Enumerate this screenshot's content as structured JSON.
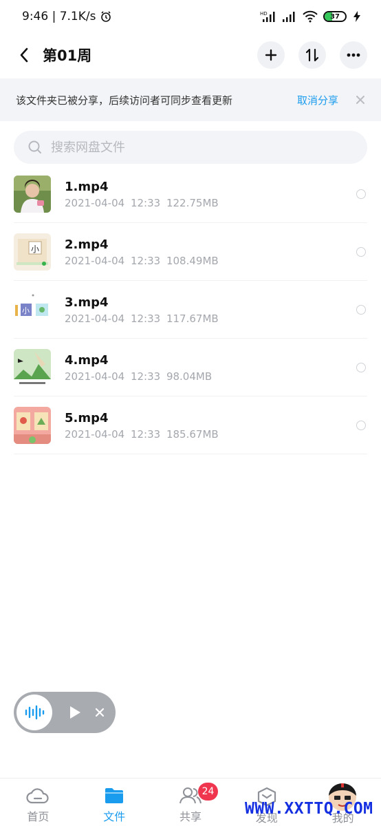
{
  "status_bar": {
    "time_speed": "9:46 | 7.1K/s",
    "battery": "37"
  },
  "header": {
    "title": "第01周"
  },
  "share_banner": {
    "text": "该文件夹已被分享，后续访问者可同步查看更新",
    "cancel_label": "取消分享"
  },
  "search": {
    "placeholder": "搜索网盘文件"
  },
  "files": [
    {
      "name": "1.mp4",
      "date": "2021-04-04  12:33",
      "size": "122.75MB"
    },
    {
      "name": "2.mp4",
      "date": "2021-04-04  12:33",
      "size": "108.49MB"
    },
    {
      "name": "3.mp4",
      "date": "2021-04-04  12:33",
      "size": "117.67MB"
    },
    {
      "name": "4.mp4",
      "date": "2021-04-04  12:33",
      "size": "98.04MB"
    },
    {
      "name": "5.mp4",
      "date": "2021-04-04  12:33",
      "size": "185.67MB"
    }
  ],
  "thumb_text": {
    "t2": "小",
    "t3": "小"
  },
  "tabs": [
    {
      "label": "首页"
    },
    {
      "label": "文件"
    },
    {
      "label": "共享",
      "badge": "24"
    },
    {
      "label": "发现"
    },
    {
      "label": "我的"
    }
  ],
  "watermark": "WWW.XXTTQ.COM",
  "colors": {
    "accent": "#1a9cee",
    "badge": "#f0364f",
    "banner_bg": "#f3f4f7"
  }
}
